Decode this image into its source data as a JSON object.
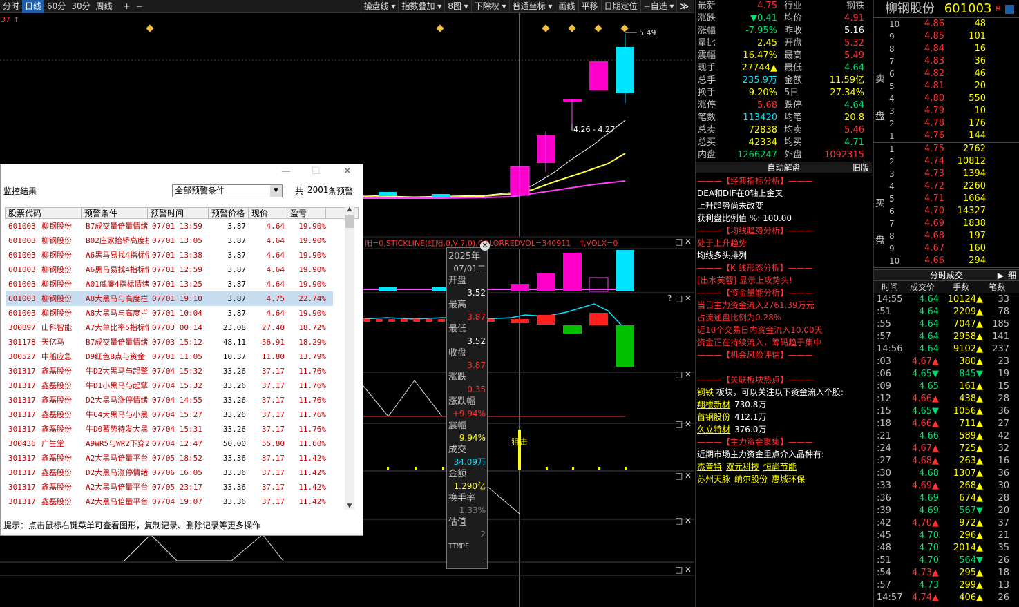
{
  "toolbar": {
    "left_items": [
      "分时",
      "日线",
      "60分",
      "30分",
      "周线"
    ],
    "active_index": 1,
    "plus": "+",
    "minus": "−",
    "right_items": [
      "操盘线 ▾",
      "指数叠加 ▾",
      "8图 ▾",
      "下除权 ▾",
      "普通坐标 ▾",
      "画线",
      "平移",
      "日期定位",
      "−自选 ▾"
    ],
    "collapse": "≫"
  },
  "chart": {
    "corner_label": "37",
    "high_label": "5.49",
    "range_label": "4.26 - 4.27",
    "indicator_header": {
      "part1": "阳=0,STICKLINE(红阳,0,V,7,0),COLORREDVOL=340911",
      "part2": ",VOLX=0"
    },
    "signal_label": "狙击",
    "panel_ctrl_q": "?",
    "panel_ctrl_max": "□",
    "panel_ctrl_close": "✕"
  },
  "tooltip": {
    "year": "2025年",
    "date": "07/01二",
    "rows": [
      {
        "label": "开盘",
        "value": "3.52",
        "color": "#ffffff"
      },
      {
        "label": "最高",
        "value": "3.87",
        "color": "#ff3333"
      },
      {
        "label": "最低",
        "value": "3.52",
        "color": "#ffffff"
      },
      {
        "label": "收盘",
        "value": "3.87",
        "color": "#ff3333"
      },
      {
        "label": "涨跌",
        "value": "0.35",
        "color": "#ff3333"
      },
      {
        "label": "涨跌幅",
        "value": "+9.94%",
        "color": "#ff3333"
      },
      {
        "label": "震幅",
        "value": "9.94%",
        "color": "#ffff00"
      },
      {
        "label": "成交",
        "value": "34.09万",
        "color": "#00e5ff"
      },
      {
        "label": "金额",
        "value": "1.290亿",
        "color": "#ffff00"
      },
      {
        "label": "换手率",
        "value": "1.33%",
        "color": "#808080"
      },
      {
        "label": "估值",
        "value": "2",
        "color": "#808080"
      }
    ],
    "footer": "TTMPE",
    "footer_val": "-"
  },
  "dialog": {
    "title": "监控结果",
    "filter_value": "全部预警条件",
    "count_prefix": "共",
    "count": "2001",
    "count_suffix": "条预警",
    "columns": [
      "股票代码",
      "预警条件",
      "预警时间",
      "预警价格",
      "现价",
      "盈亏"
    ],
    "rows": [
      [
        "601003",
        "柳钢股份",
        "B7成交量倍量情绪",
        "07/01 13:59",
        "3.87",
        "4.64",
        "19.90%"
      ],
      [
        "601003",
        "柳钢股份",
        "B02庄家抬轿高度拦",
        "07/01 13:05",
        "3.87",
        "4.64",
        "19.90%"
      ],
      [
        "601003",
        "柳钢股份",
        "A6黑马易找4指标情",
        "07/01 13:38",
        "3.87",
        "4.64",
        "19.90%"
      ],
      [
        "601003",
        "柳钢股份",
        "A6黑马易找4指标情",
        "07/01 12:59",
        "3.87",
        "4.64",
        "19.90%"
      ],
      [
        "601003",
        "柳钢股份",
        "A01威廉4指标情绪",
        "07/01 13:25",
        "3.87",
        "4.64",
        "19.90%"
      ],
      [
        "601003",
        "柳钢股份",
        "A8大黑马与高度拦",
        "07/01 19:10",
        "3.87",
        "4.75",
        "22.74%"
      ],
      [
        "601003",
        "柳钢股份",
        "A8大黑马与高度拦",
        "07/01 10:04",
        "3.87",
        "4.64",
        "19.90%"
      ],
      [
        "300897",
        "山科智能",
        "A7大单比率5指标情",
        "07/03 00:14",
        "23.08",
        "27.40",
        "18.72%"
      ],
      [
        "301178",
        "天亿马",
        "B7成交量倍量情绪",
        "07/03 15:12",
        "48.11",
        "56.91",
        "18.29%"
      ],
      [
        "300527",
        "中船应急",
        "D9红色B点与资金",
        "07/01 11:05",
        "10.37",
        "11.80",
        "13.79%"
      ],
      [
        "301317",
        "鑫磊股份",
        "牛D2大黑马与起擎",
        "07/04 15:32",
        "33.26",
        "37.17",
        "11.76%"
      ],
      [
        "301317",
        "鑫磊股份",
        "牛D1小黑马与起擎",
        "07/04 15:32",
        "33.26",
        "37.17",
        "11.76%"
      ],
      [
        "301317",
        "鑫磊股份",
        "D2大黑马涨停情绪",
        "07/04 14:55",
        "33.26",
        "37.17",
        "11.76%"
      ],
      [
        "301317",
        "鑫磊股份",
        "牛C4大黑马与小黑",
        "07/04 15:27",
        "33.26",
        "37.17",
        "11.76%"
      ],
      [
        "301317",
        "鑫磊股份",
        "牛D0蓄势待发大黑",
        "07/04 15:31",
        "33.26",
        "37.17",
        "11.76%"
      ],
      [
        "300436",
        "广生堂",
        "A9WR5与WR2下穿20",
        "07/04 12:47",
        "50.00",
        "55.80",
        "11.60%"
      ],
      [
        "301317",
        "鑫磊股份",
        "A2大黑马倍量平台",
        "07/05 18:52",
        "33.36",
        "37.17",
        "11.42%"
      ],
      [
        "301317",
        "鑫磊股份",
        "D2大黑马涨停情绪",
        "07/06 16:05",
        "33.36",
        "37.17",
        "11.42%"
      ],
      [
        "301317",
        "鑫磊股份",
        "A2大黑马倍量平台",
        "07/05 23:17",
        "33.36",
        "37.17",
        "11.42%"
      ],
      [
        "301317",
        "鑫磊股份",
        "A2大黑马倍量平台",
        "07/04 19:07",
        "33.36",
        "37.17",
        "11.42%"
      ]
    ],
    "selected_row": 5,
    "hint": "提示：点击鼠标右键菜单可查看图形，复制记录、删除记录等更多操作"
  },
  "quote": {
    "rows": [
      {
        "l1": "最新",
        "v1": "4.75",
        "c1": "#ff3333",
        "l2": "行业",
        "v2": "钢铁",
        "c2": "#c0c0c0"
      },
      {
        "l1": "涨跌",
        "v1": "▼0.41",
        "c1": "#00e070",
        "l2": "均价",
        "v2": "4.91",
        "c2": "#ff3333"
      },
      {
        "l1": "涨幅",
        "v1": "-7.95%",
        "c1": "#00e070",
        "l2": "昨收",
        "v2": "5.16",
        "c2": "#ffffff"
      },
      {
        "l1": "量比",
        "v1": "2.45",
        "c1": "#ffff00",
        "l2": "开盘",
        "v2": "5.32",
        "c2": "#ff3333"
      },
      {
        "l1": "震幅",
        "v1": "16.47%",
        "c1": "#ffff00",
        "l2": "最高",
        "v2": "5.49",
        "c2": "#ff3333"
      },
      {
        "l1": "现手",
        "v1": "27744▲",
        "c1": "#ffff00",
        "l2": "最低",
        "v2": "4.64",
        "c2": "#00e070"
      },
      {
        "l1": "总手",
        "v1": "235.9万",
        "c1": "#00e5ff",
        "l2": "金额",
        "v2": "11.59亿",
        "c2": "#ffff00"
      },
      {
        "l1": "换手",
        "v1": "9.20%",
        "c1": "#ffff00",
        "l2": "5日",
        "v2": "27.34%",
        "c2": "#ffff00"
      },
      {
        "l1": "涨停",
        "v1": "5.68",
        "c1": "#ff3333",
        "l2": "跌停",
        "v2": "4.64",
        "c2": "#00e070"
      },
      {
        "l1": "笔数",
        "v1": "113420",
        "c1": "#00e5ff",
        "l2": "均笔",
        "v2": "20.8",
        "c2": "#ffff00"
      },
      {
        "l1": "总卖",
        "v1": "72838",
        "c1": "#ffff00",
        "l2": "均卖",
        "v2": "5.46",
        "c2": "#ff3333"
      },
      {
        "l1": "总买",
        "v1": "42334",
        "c1": "#ffff00",
        "l2": "均买",
        "v2": "4.71",
        "c2": "#00e070"
      },
      {
        "l1": "内盘",
        "v1": "1266247",
        "c1": "#00e070",
        "l2": "外盘",
        "v2": "1092315",
        "c2": "#ff3333"
      }
    ],
    "auto_title": "自动解盘",
    "auto_right": "旧版",
    "analysis": [
      {
        "t": "———【经典指标分析】———",
        "c": "#ff3333"
      },
      {
        "t": "DEA和DIF在0轴上金叉",
        "c": "#ffffff"
      },
      {
        "t": "上升趋势尚未改变",
        "c": "#ffffff"
      },
      {
        "t": "获利盘比例值 %: 100.00",
        "c": "#ffffff"
      },
      {
        "t": "———【均线趋势分析】———",
        "c": "#ff3333"
      },
      {
        "t": "处于上升趋势",
        "c": "#ff3333"
      },
      {
        "t": "均线多头排列",
        "c": "#ffffff"
      },
      {
        "t": "———【K 线形态分析】———",
        "c": "#ff3333"
      },
      {
        "t": "[出水芙蓉] 显示上攻势头!",
        "c": "#ff3333"
      },
      {
        "t": "———【资金量能分析】———",
        "c": "#ff3333"
      },
      {
        "t": "当日主力资金流入2761.39万元",
        "c": "#ff3333"
      },
      {
        "t": "占流通盘比例为0.28%",
        "c": "#ff3333"
      },
      {
        "t": "近10个交易日内资金流入10.00天",
        "c": "#ff3333"
      },
      {
        "t": "资金正在持续流入，筹码趋于集中",
        "c": "#ff3333"
      },
      {
        "t": "———【机会风险评估】———",
        "c": "#ff3333"
      },
      {
        "t": "",
        "c": "#ffffff"
      },
      {
        "t": "———【关联板块热点】———",
        "c": "#ff3333"
      }
    ],
    "sector_line_pre": "钢铁",
    "sector_line": " 板块，可以关注以下资金流入个股:",
    "flows": [
      {
        "name": "翔楼新材",
        "amt": "730.8万"
      },
      {
        "name": "首钢股份",
        "amt": "412.1万"
      },
      {
        "name": "久立特材",
        "amt": "376.0万"
      }
    ],
    "capital_title": "———【主力资金聚集】———",
    "capital_sub": "近期市场主力资金重点介入品种有:",
    "stocks_line1": [
      "杰普特",
      "双元科技",
      "恒尚节能"
    ],
    "stocks_line2": [
      "苏州天脉",
      "纳尔股份",
      "惠城环保"
    ]
  },
  "book": {
    "name": "柳钢股份",
    "code": "601003",
    "badge_r": "R",
    "sell_label": [
      "卖",
      "盘"
    ],
    "buy_label": [
      "买",
      "盘"
    ],
    "sells": [
      [
        "10",
        "4.86",
        "48"
      ],
      [
        "9",
        "4.85",
        "101"
      ],
      [
        "8",
        "4.84",
        "16"
      ],
      [
        "7",
        "4.83",
        "36"
      ],
      [
        "6",
        "4.82",
        "46"
      ],
      [
        "5",
        "4.81",
        "20"
      ],
      [
        "4",
        "4.80",
        "550"
      ],
      [
        "3",
        "4.79",
        "10"
      ],
      [
        "2",
        "4.78",
        "176"
      ],
      [
        "1",
        "4.76",
        "144"
      ]
    ],
    "buys": [
      [
        "1",
        "4.75",
        "2762"
      ],
      [
        "2",
        "4.74",
        "10812"
      ],
      [
        "3",
        "4.73",
        "1394"
      ],
      [
        "4",
        "4.72",
        "2260"
      ],
      [
        "5",
        "4.71",
        "1664"
      ],
      [
        "6",
        "4.70",
        "14327"
      ],
      [
        "7",
        "4.69",
        "1838"
      ],
      [
        "8",
        "4.68",
        "197"
      ],
      [
        "9",
        "4.67",
        "160"
      ],
      [
        "10",
        "4.66",
        "294"
      ]
    ],
    "ticks_title": "分时成交",
    "ticks_btn": "▶",
    "ticks_btn2": "细",
    "tick_cols": [
      "时间",
      "成交价",
      "手数",
      "笔数"
    ],
    "ticks": [
      [
        "14:55",
        "4.64",
        "10124▲",
        "33"
      ],
      [
        ":51",
        "4.64",
        "2209▲",
        "78"
      ],
      [
        ":55",
        "4.64",
        "7047▲",
        "185"
      ],
      [
        ":57",
        "4.64",
        "2958▲",
        "141"
      ],
      [
        "14:56",
        "4.64",
        "9102▲",
        "237"
      ],
      [
        ":03",
        "4.67▲",
        "380▲",
        "23"
      ],
      [
        ":06",
        "4.65▼",
        "845▼",
        "19"
      ],
      [
        ":09",
        "4.65",
        "161▲",
        "15"
      ],
      [
        ":12",
        "4.66▲",
        "438▲",
        "28"
      ],
      [
        ":15",
        "4.65▼",
        "1056▲",
        "36"
      ],
      [
        ":18",
        "4.66▲",
        "711▲",
        "27"
      ],
      [
        ":21",
        "4.66",
        "589▲",
        "42"
      ],
      [
        ":24",
        "4.67▲",
        "725▲",
        "32"
      ],
      [
        ":27",
        "4.68▲",
        "263▲",
        "16"
      ],
      [
        ":30",
        "4.68",
        "1307▲",
        "36"
      ],
      [
        ":33",
        "4.69▲",
        "268▲",
        "30"
      ],
      [
        ":36",
        "4.69",
        "674▲",
        "28"
      ],
      [
        ":39",
        "4.69",
        "567▼",
        "20"
      ],
      [
        ":42",
        "4.70▲",
        "972▲",
        "37"
      ],
      [
        ":45",
        "4.70",
        "296▲",
        "21"
      ],
      [
        ":48",
        "4.70",
        "2014▲",
        "35"
      ],
      [
        ":51",
        "4.70",
        "564▼",
        "26"
      ],
      [
        ":54",
        "4.73▲",
        "295▲",
        "18"
      ],
      [
        ":57",
        "4.73",
        "299▲",
        "13"
      ],
      [
        "14:57",
        "4.74▲",
        "406▲",
        "26"
      ]
    ]
  }
}
